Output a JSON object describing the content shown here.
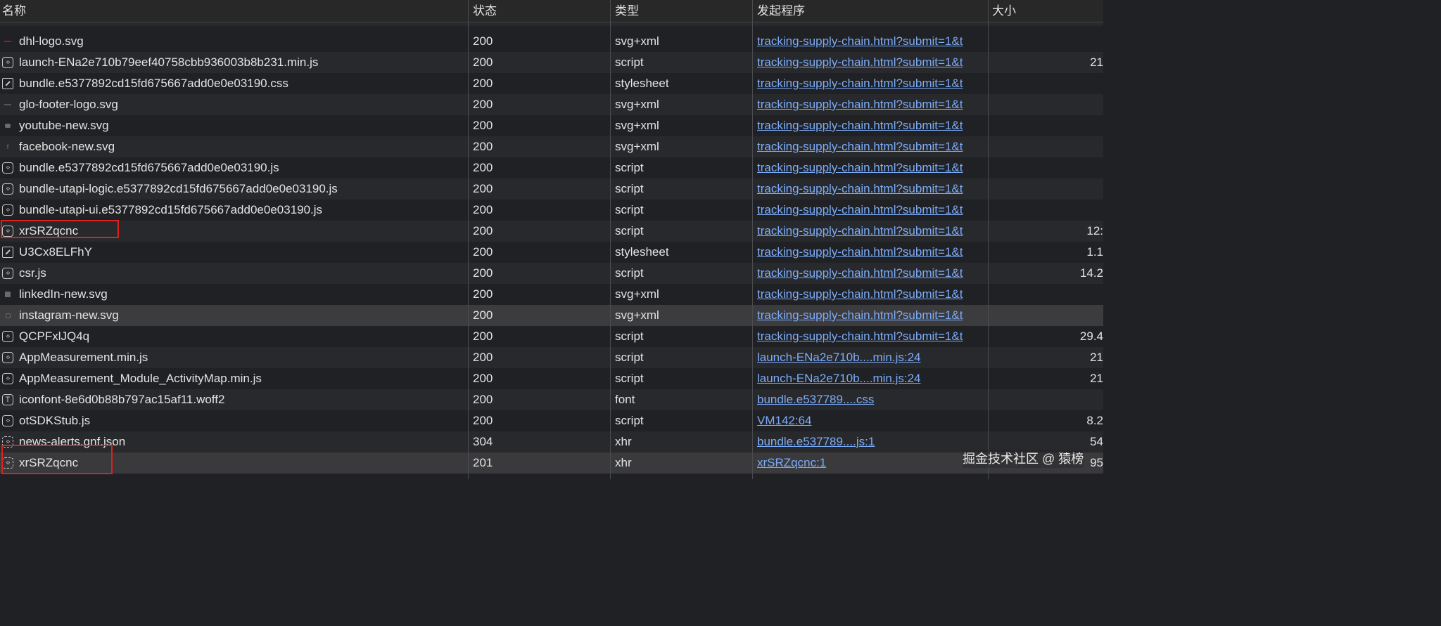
{
  "columns": {
    "name": "名称",
    "status": "状态",
    "type": "类型",
    "initiator": "发起程序",
    "size": "大小"
  },
  "rows": [
    {
      "name": "dhl-logo.svg",
      "icon": "dhl-logo-image-icon",
      "status": "200",
      "type": "svg+xml",
      "initiator": "tracking-supply-chain.html?submit=1&t",
      "size": ""
    },
    {
      "name": "launch-ENa2e710b79eef40758cbb936003b8b231.min.js",
      "icon": "script-icon",
      "status": "200",
      "type": "script",
      "initiator": "tracking-supply-chain.html?submit=1&t",
      "size": "21"
    },
    {
      "name": "bundle.e5377892cd15fd675667add0e0e03190.css",
      "icon": "stylesheet-icon",
      "status": "200",
      "type": "stylesheet",
      "initiator": "tracking-supply-chain.html?submit=1&t",
      "size": ""
    },
    {
      "name": "glo-footer-logo.svg",
      "icon": "footer-logo-image-icon",
      "status": "200",
      "type": "svg+xml",
      "initiator": "tracking-supply-chain.html?submit=1&t",
      "size": ""
    },
    {
      "name": "youtube-new.svg",
      "icon": "youtube-image-icon",
      "status": "200",
      "type": "svg+xml",
      "initiator": "tracking-supply-chain.html?submit=1&t",
      "size": ""
    },
    {
      "name": "facebook-new.svg",
      "icon": "facebook-image-icon",
      "status": "200",
      "type": "svg+xml",
      "initiator": "tracking-supply-chain.html?submit=1&t",
      "size": ""
    },
    {
      "name": "bundle.e5377892cd15fd675667add0e0e03190.js",
      "icon": "script-icon",
      "status": "200",
      "type": "script",
      "initiator": "tracking-supply-chain.html?submit=1&t",
      "size": ""
    },
    {
      "name": "bundle-utapi-logic.e5377892cd15fd675667add0e0e03190.js",
      "icon": "script-icon",
      "status": "200",
      "type": "script",
      "initiator": "tracking-supply-chain.html?submit=1&t",
      "size": ""
    },
    {
      "name": "bundle-utapi-ui.e5377892cd15fd675667add0e0e03190.js",
      "icon": "script-icon",
      "status": "200",
      "type": "script",
      "initiator": "tracking-supply-chain.html?submit=1&t",
      "size": ""
    },
    {
      "name": "xrSRZqcnc",
      "icon": "script-icon",
      "status": "200",
      "type": "script",
      "initiator": "tracking-supply-chain.html?submit=1&t",
      "size": "12:"
    },
    {
      "name": "U3Cx8ELFhY",
      "icon": "stylesheet-icon",
      "status": "200",
      "type": "stylesheet",
      "initiator": "tracking-supply-chain.html?submit=1&t",
      "size": "1.1"
    },
    {
      "name": "csr.js",
      "icon": "script-icon",
      "status": "200",
      "type": "script",
      "initiator": "tracking-supply-chain.html?submit=1&t",
      "size": "14.2"
    },
    {
      "name": "linkedIn-new.svg",
      "icon": "linkedin-image-icon",
      "status": "200",
      "type": "svg+xml",
      "initiator": "tracking-supply-chain.html?submit=1&t",
      "size": ""
    },
    {
      "name": "instagram-new.svg",
      "icon": "instagram-image-icon",
      "status": "200",
      "type": "svg+xml",
      "initiator": "tracking-supply-chain.html?submit=1&t",
      "size": ""
    },
    {
      "name": "QCPFxlJQ4q",
      "icon": "script-icon",
      "status": "200",
      "type": "script",
      "initiator": "tracking-supply-chain.html?submit=1&t",
      "size": "29.4"
    },
    {
      "name": "AppMeasurement.min.js",
      "icon": "script-icon",
      "status": "200",
      "type": "script",
      "initiator": "launch-ENa2e710b....min.js:24",
      "size": "21"
    },
    {
      "name": "AppMeasurement_Module_ActivityMap.min.js",
      "icon": "script-icon",
      "status": "200",
      "type": "script",
      "initiator": "launch-ENa2e710b....min.js:24",
      "size": "21"
    },
    {
      "name": "iconfont-8e6d0b88b797ac15af11.woff2",
      "icon": "font-icon",
      "status": "200",
      "type": "font",
      "initiator": "bundle.e537789....css",
      "size": ""
    },
    {
      "name": "otSDKStub.js",
      "icon": "script-icon",
      "status": "200",
      "type": "script",
      "initiator": "VM142:64",
      "size": "8.2"
    },
    {
      "name": "news-alerts.gnf.json",
      "icon": "xhr-icon",
      "status": "304",
      "type": "xhr",
      "initiator": "bundle.e537789....js:1",
      "size": "54"
    },
    {
      "name": "xrSRZqcnc",
      "icon": "xhr-icon",
      "status": "201",
      "type": "xhr",
      "initiator": "xrSRZqcnc:1",
      "size": "95"
    }
  ],
  "watermark": "掘金技术社区 @ 猿榜"
}
